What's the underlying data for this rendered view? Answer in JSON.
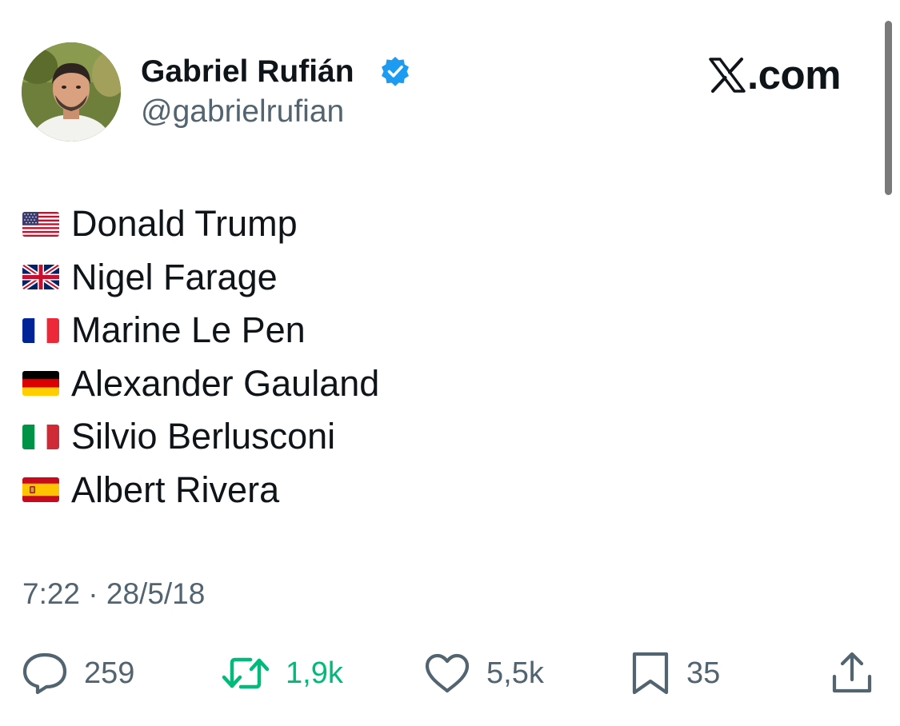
{
  "author": {
    "display_name": "Gabriel Rufián",
    "handle": "@gabrielrufian",
    "verified": true
  },
  "brand": {
    "label": ".com",
    "icon": "x-logo-icon"
  },
  "tweet": {
    "lines": [
      {
        "flag": "flag-us-icon",
        "text": "Donald Trump"
      },
      {
        "flag": "flag-uk-icon",
        "text": "Nigel Farage"
      },
      {
        "flag": "flag-fr-icon",
        "text": "Marine Le Pen"
      },
      {
        "flag": "flag-de-icon",
        "text": "Alexander Gauland"
      },
      {
        "flag": "flag-it-icon",
        "text": "Silvio Berlusconi"
      },
      {
        "flag": "flag-es-icon",
        "text": "Albert Rivera"
      }
    ],
    "timestamp": "7:22 · 28/5/18"
  },
  "actions": {
    "replies": "259",
    "retweets": "1,9k",
    "likes": "5,5k",
    "bookmarks": "35"
  },
  "colors": {
    "text": "#0f1419",
    "secondary": "#536471",
    "verified": "#1d9bf0",
    "retweet_active": "#00ba7c"
  }
}
